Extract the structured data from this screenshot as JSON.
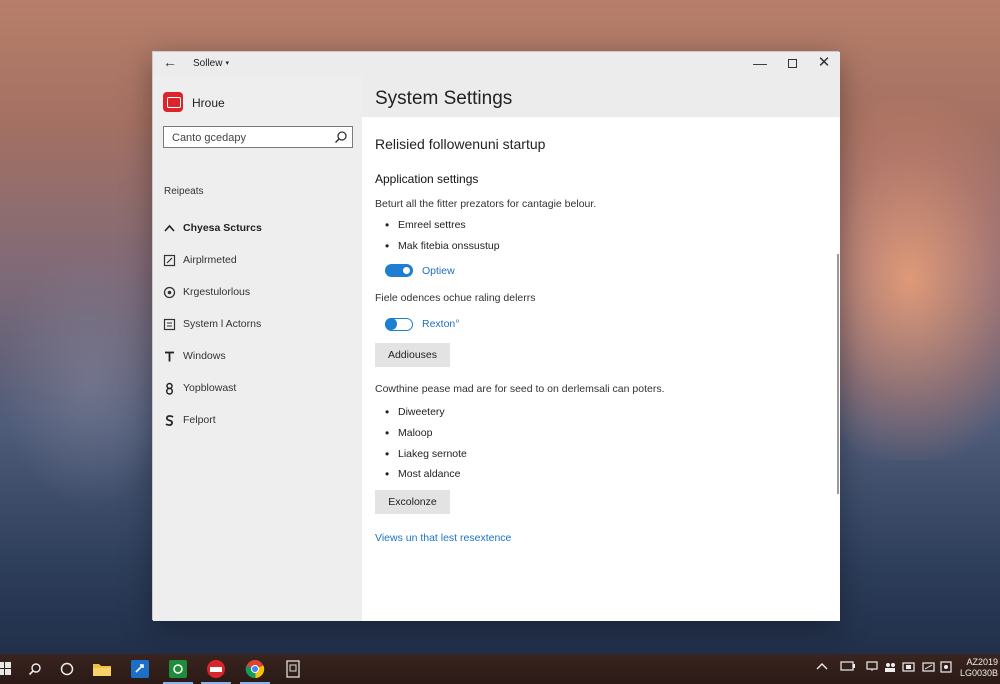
{
  "window": {
    "title": "Sollew",
    "back_label": "←",
    "min_label": "—",
    "close_label": "✕"
  },
  "sidebar": {
    "app_name": "Hroue",
    "search": {
      "value": "Canto gcedapy"
    },
    "section_label": "Reipeats",
    "items": [
      {
        "label": "Chyesa Scturcs",
        "icon": "chevron-up-icon",
        "active": true
      },
      {
        "label": "Airplrmeted",
        "icon": "edit-box-icon",
        "active": false
      },
      {
        "label": "Krgestulorlous",
        "icon": "globe-icon",
        "active": false
      },
      {
        "label": "System l Actorns",
        "icon": "list-box-icon",
        "active": false
      },
      {
        "label": "Windows",
        "icon": "text-t-icon",
        "active": false
      },
      {
        "label": "Yopblowast",
        "icon": "figure-8-icon",
        "active": false
      },
      {
        "label": "Felport",
        "icon": "s-shape-icon",
        "active": false
      }
    ]
  },
  "main": {
    "page_title": "System Settings",
    "subtitle": "Relisied followenuni startup",
    "group_heading": "Application settings",
    "para1": "Beturt all the fitter prezators for cantagie belour.",
    "bullets1": [
      "Emreel settres",
      "Mak fitebia onssustup"
    ],
    "toggle1": {
      "label": "Optiew",
      "state": "on"
    },
    "para2": "Fiele odences ochue raling delerrs",
    "toggle2": {
      "label": "Rexton°",
      "state": "half"
    },
    "button1": "Addiouses",
    "para3": "Cowthine pease mad are for seed to on derlemsali can poters.",
    "bullets2": [
      "Diweetery",
      "Maloop",
      "Liakeg sernote",
      "Most aldance"
    ],
    "button2": "Excolonze",
    "link": "Views un that lest resextence"
  },
  "taskbar": {
    "clock_line1": "AZ2019",
    "clock_line2": "LG0030B",
    "colors": {
      "accent": "#1e7fd2",
      "app_logo": "#d9252b"
    }
  }
}
